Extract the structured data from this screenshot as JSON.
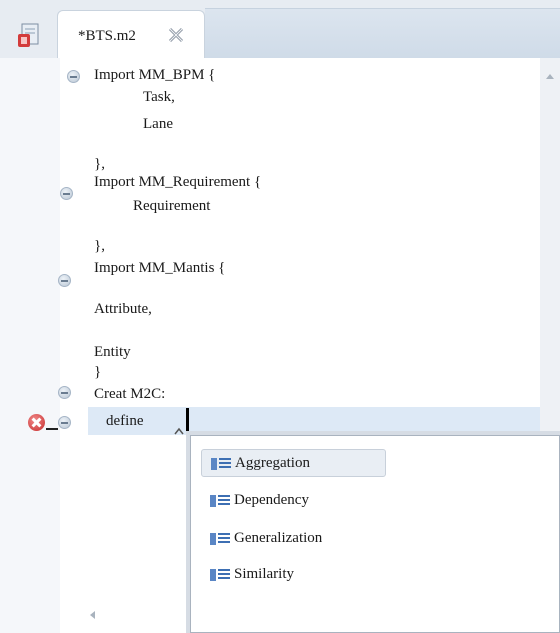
{
  "tab": {
    "title": "*BTS.m2"
  },
  "code_lines": [
    "Import MM_BPM {",
    "Task,",
    "Lane",
    "},",
    "Import MM_Requirement {",
    "Requirement",
    "},",
    "Import MM_Mantis {",
    "Attribute,",
    "Entity",
    "}",
    "Creat M2C:",
    "define"
  ],
  "content_assist": {
    "items": [
      "Aggregation",
      "Dependency",
      "Generalization",
      "Similarity"
    ],
    "selected": "Aggregation"
  },
  "colors": {
    "current_line": "#dde9f6",
    "error": "#c72c2c"
  }
}
